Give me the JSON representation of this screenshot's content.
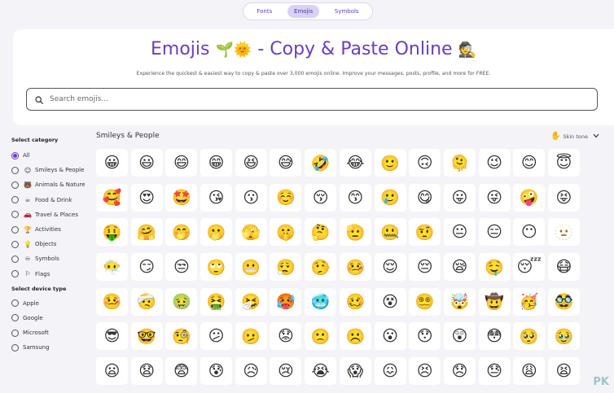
{
  "tabs": [
    {
      "label": "Fonts",
      "active": false
    },
    {
      "label": "Emojis",
      "active": true
    },
    {
      "label": "Symbols",
      "active": false
    }
  ],
  "hero": {
    "title_text": "Emojis",
    "title_emojis": "🌱🌞",
    "title_rest": "- Copy & Paste Online",
    "title_emoji_end": "🕵️",
    "subtitle": "Experience the quickest & easiest way to copy & paste over 3,000 emojis online. Improve your messages, posts, profile, and more for FREE."
  },
  "search": {
    "placeholder": "Search emojis..."
  },
  "category": {
    "heading": "Select category",
    "options": [
      {
        "label": "All",
        "icon": "",
        "selected": true
      },
      {
        "label": "Smileys & People",
        "icon": "☺",
        "selected": false
      },
      {
        "label": "Animals & Nature",
        "icon": "🐻",
        "selected": false
      },
      {
        "label": "Food & Drink",
        "icon": "☕",
        "selected": false
      },
      {
        "label": "Travel & Places",
        "icon": "🚗",
        "selected": false
      },
      {
        "label": "Activities",
        "icon": "🏆",
        "selected": false
      },
      {
        "label": "Objects",
        "icon": "💡",
        "selected": false
      },
      {
        "label": "Symbols",
        "icon": "♾",
        "selected": false
      },
      {
        "label": "Flags",
        "icon": "⚐",
        "selected": false
      }
    ]
  },
  "device": {
    "heading": "Select device type",
    "options": [
      {
        "label": "Apple",
        "selected": false
      },
      {
        "label": "Google",
        "selected": false
      },
      {
        "label": "Microsoft",
        "selected": false
      },
      {
        "label": "Samsung",
        "selected": false
      }
    ]
  },
  "main": {
    "heading": "Smileys & People",
    "skin_label": "Skin tone",
    "skin_icon": "✋"
  },
  "emojis": [
    "😀",
    "😃",
    "😄",
    "😁",
    "😆",
    "😅",
    "🤣",
    "😂",
    "🙂",
    "🙃",
    "🫠",
    "😉",
    "😊",
    "😇",
    "🥰",
    "😍",
    "🤩",
    "😘",
    "😗",
    "☺️",
    "😚",
    "😙",
    "🥲",
    "😋",
    "😛",
    "😜",
    "🤪",
    "😝",
    "🤑",
    "🤗",
    "🤭",
    "🫢",
    "🫣",
    "🤫",
    "🤔",
    "🫡",
    "🤐",
    "🤨",
    "😐",
    "😑",
    "😶",
    "🫥",
    "😶‍🌫️",
    "😏",
    "😒",
    "🙄",
    "😬",
    "😮‍💨",
    "🤥",
    "🤒",
    "😌",
    "😔",
    "😪",
    "🤤",
    "😴",
    "😷",
    "🤒",
    "🤕",
    "🤢",
    "🤮",
    "🤧",
    "🥵",
    "🥶",
    "🥴",
    "😵",
    "😵‍💫",
    "🤯",
    "🤠",
    "🥳",
    "🥸",
    "😎",
    "🤓",
    "🧐",
    "😕",
    "🫤",
    "😟",
    "🙁",
    "☹️",
    "😮",
    "😯",
    "😲",
    "😳",
    "🥺",
    "🥹",
    "😦",
    "😧",
    "😨",
    "😰",
    "😥",
    "😢",
    "😭",
    "😱",
    "😖",
    "😣",
    "😞",
    "😓",
    "😩",
    "😫"
  ],
  "watermark": "PK"
}
